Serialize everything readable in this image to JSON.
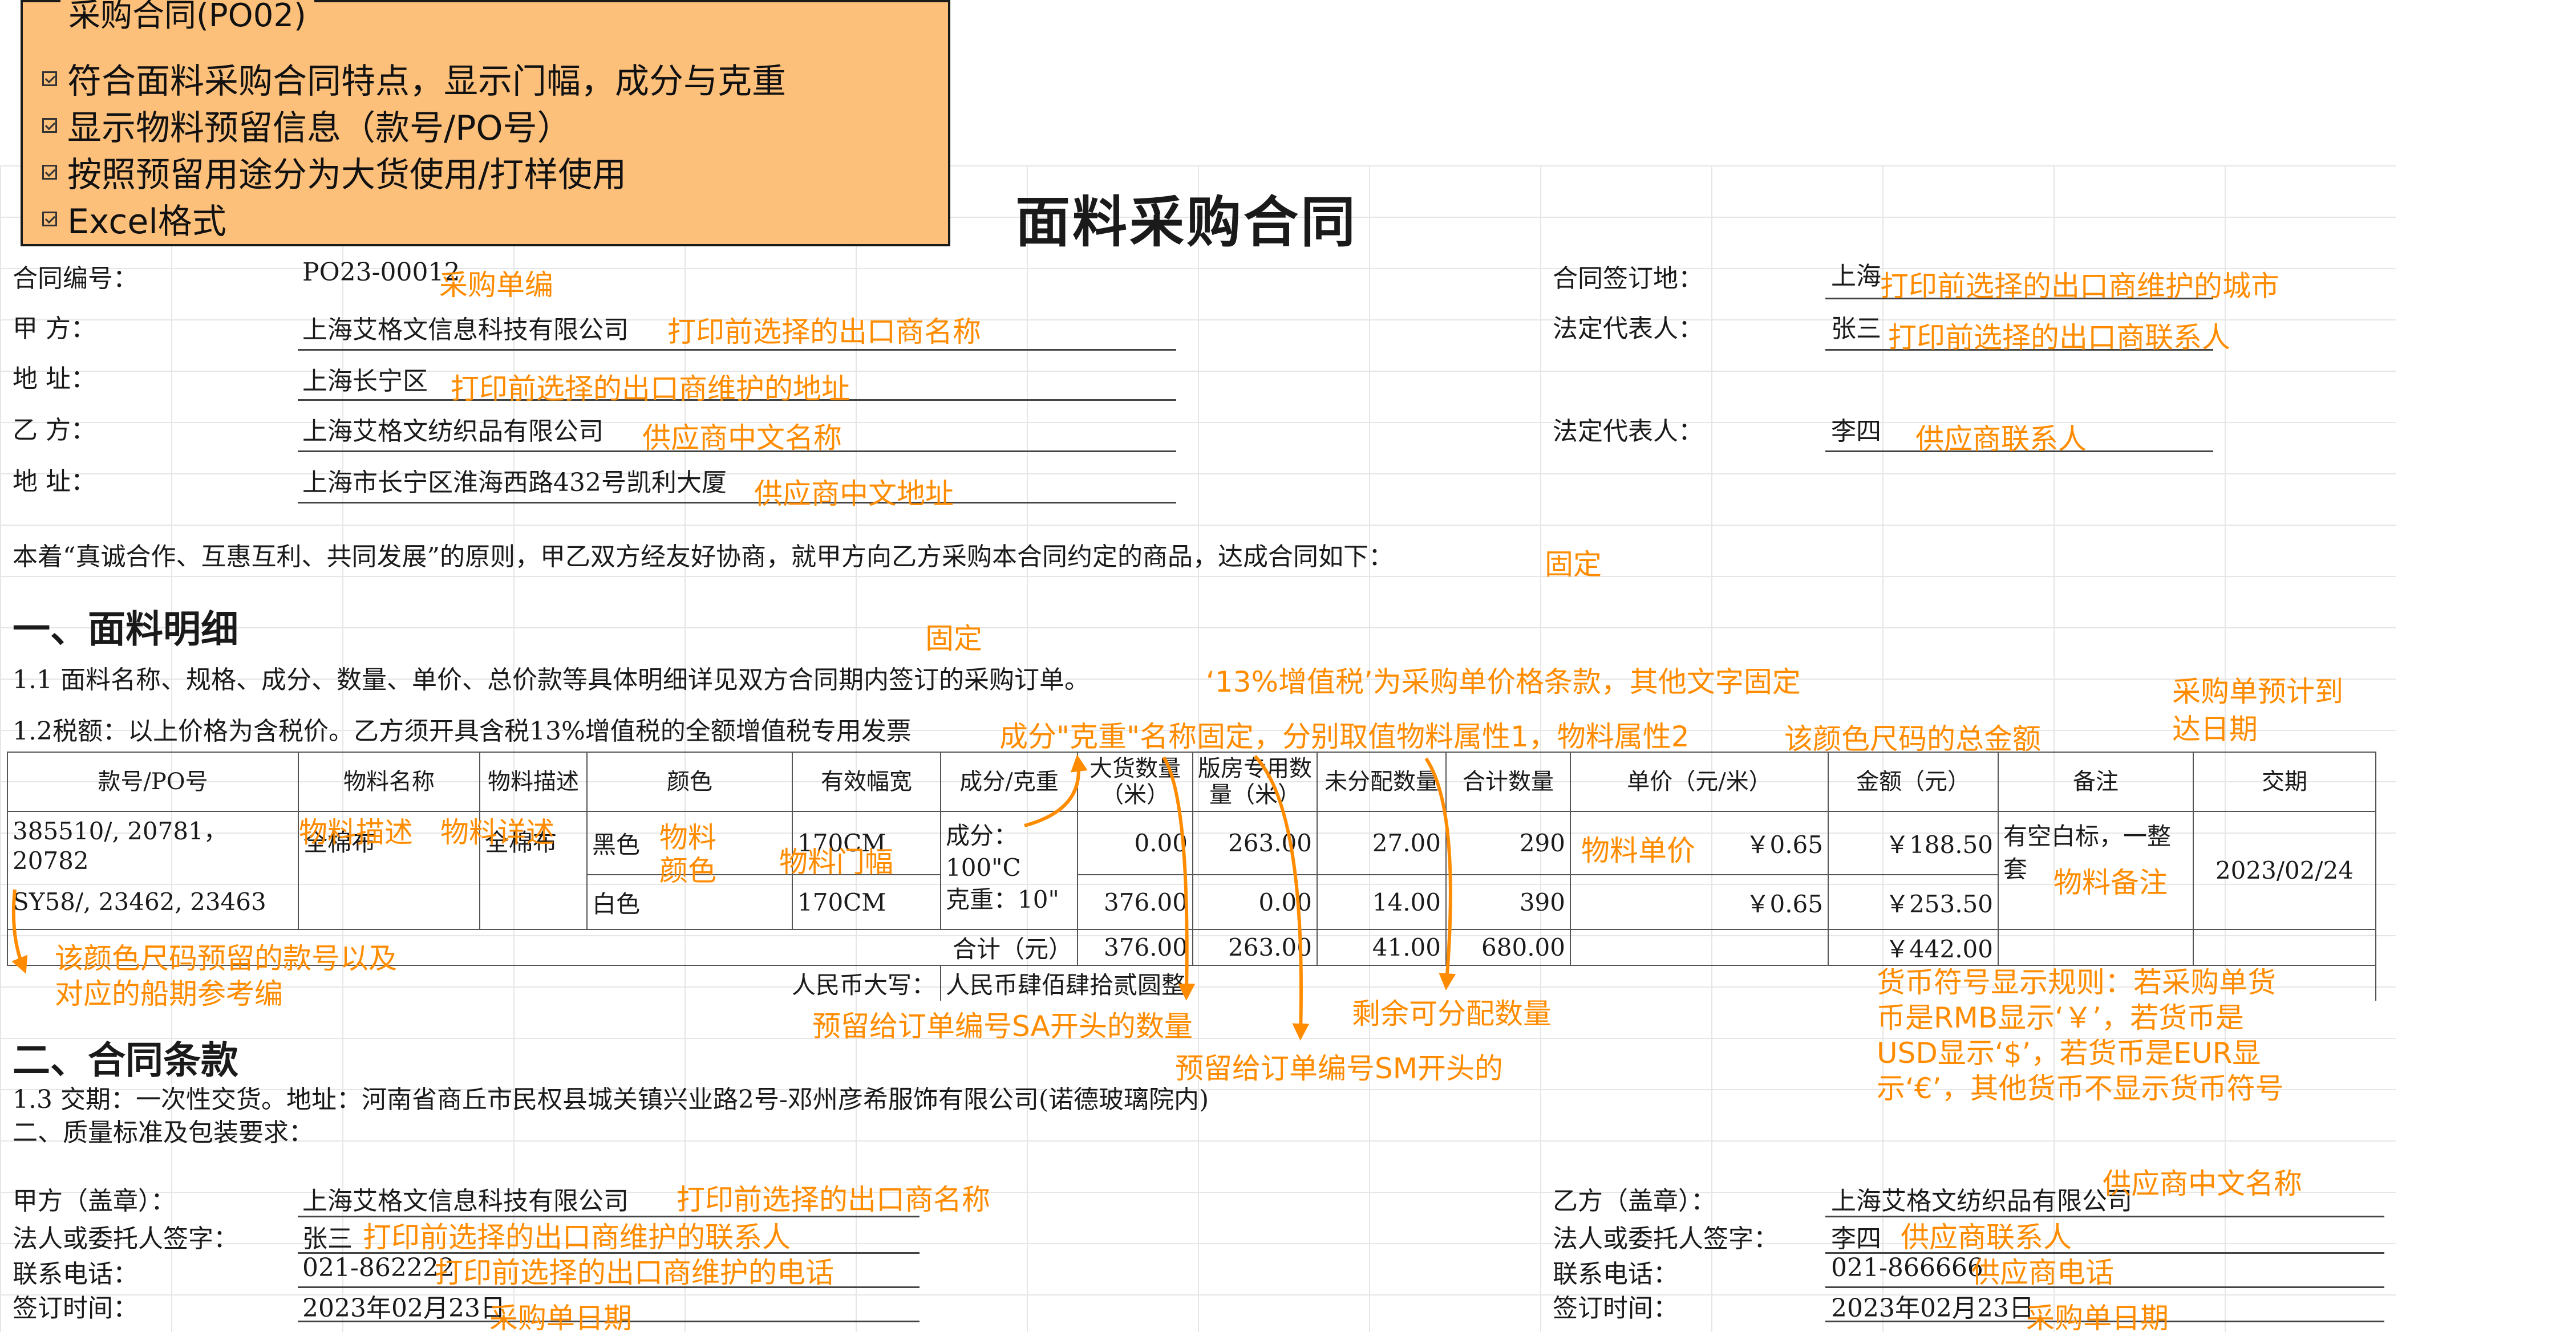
{
  "callout": {
    "title": "采购合同(PO02)",
    "items": [
      "符合面料采购合同特点，显示门幅，成分与克重",
      "显示物料预留信息（款号/PO号）",
      "按照预留用途分为大货使用/打样使用",
      "Excel格式"
    ]
  },
  "doc_title": "面料采购合同",
  "header": {
    "contract_no_label": "合同编号：",
    "contract_no": "PO23-00012",
    "party_a_label": "甲    方：",
    "party_a": "上海艾格文信息科技有限公司",
    "addr_a_label": "地    址：",
    "addr_a": "上海长宁区",
    "party_b_label": "乙    方：",
    "party_b": "上海艾格文纺织品有限公司",
    "addr_b_label": "地    址：",
    "addr_b": "上海市长宁区淮海西路432号凯利大厦",
    "sign_place_label": "合同签订地：",
    "sign_place": "上海",
    "legal_rep_a_label": "法定代表人：",
    "legal_rep_a": "张三",
    "legal_rep_b_label": "法定代表人：",
    "legal_rep_b": "李四"
  },
  "intro": "本着“真诚合作、互惠互利、共同发展”的原则，甲乙双方经友好协商，就甲方向乙方采购本合同约定的商品，达成合同如下：",
  "section1": {
    "title": "一、面料明细",
    "clause_1_1": "1.1 面料名称、规格、成分、数量、单价、总价款等具体明细详见双方合同期内签订的采购订单。",
    "clause_1_2": "1.2税额：以上价格为含税价。乙方须开具含税13%增值税的全额增值税专用发票"
  },
  "table": {
    "headers": {
      "style_po": "款号/PO号",
      "material_name": "物料名称",
      "material_desc": "物料描述",
      "color": "颜色",
      "width": "有效幅宽",
      "composition": "成分/克重",
      "bulk_qty": "大货数量（米）",
      "sample_qty": "版房专用数量（米）",
      "unallocated": "未分配数量",
      "total_qty": "合计数量",
      "unit_price": "单价（元/米）",
      "amount": "金额（元）",
      "remark": "备注",
      "delivery": "交期"
    },
    "rows": [
      {
        "style_po": "385510/, 20781， 20782",
        "color": "黑色",
        "width": "170CM",
        "bulk_qty": "0.00",
        "sample_qty": "263.00",
        "unallocated": "27.00",
        "total_qty": "290",
        "unit_price": "￥0.65",
        "amount": "￥188.50"
      },
      {
        "style_po": "SY58/, 23462, 23463",
        "color": "白色",
        "width": "170CM",
        "bulk_qty": "376.00",
        "sample_qty": "0.00",
        "unallocated": "14.00",
        "total_qty": "390",
        "unit_price": "￥0.65",
        "amount": "￥253.50"
      }
    ],
    "material_name": "全棉布",
    "material_desc": "全棉布",
    "composition_label": "成分：",
    "composition_value": "100\"C",
    "weight_label": "克重：10\"",
    "remark": "有空白标，一整套",
    "delivery": "2023/02/24",
    "total_label": "合计（元）",
    "total_bulk": "376.00",
    "total_sample": "263.00",
    "total_unallocated": "41.00",
    "total_qty": "680.00",
    "total_amount": "￥442.00",
    "capital_label": "人民币大写：",
    "capital_value": "人民币肆佰肆拾贰圆整"
  },
  "section2": {
    "title": "二、合同条款",
    "clause_1_3": "1.3 交期：一次性交货。地址：河南省商丘市民权县城关镇兴业路2号-邓州彦希服饰有限公司(诺德玻璃院内)",
    "clause_quality": "二、质量标准及包装要求："
  },
  "signature": {
    "a_seal_label": "甲方（盖章）：",
    "a_seal": "上海艾格文信息科技有限公司",
    "a_rep_label": "法人或委托人签字：",
    "a_rep": "张三",
    "a_phone_label": "联系电话：",
    "a_phone": "021-862222",
    "a_date_label": "签订时间：",
    "a_date": "2023年02月23日",
    "b_seal_label": "乙方（盖章）：",
    "b_seal": "上海艾格文纺织品有限公司",
    "b_rep_label": "法人或委托人签字：",
    "b_rep": "李四",
    "b_phone_label": "联系电话：",
    "b_phone": "021-866666",
    "b_date_label": "签订时间：",
    "b_date": "2023年02月23日"
  },
  "annotations": {
    "po_no": "采购单编",
    "exporter_name": "打印前选择的出口商名称",
    "exporter_addr": "打印前选择的出口商维护的地址",
    "supplier_name": "供应商中文名称",
    "supplier_addr": "供应商中文地址",
    "exporter_city": "打印前选择的出口商维护的城市",
    "exporter_contact": "打印前选择的出口商联系人",
    "supplier_contact": "供应商联系人",
    "fixed_intro": "固定",
    "fixed_section": "固定",
    "vat_note": "‘13%增值税’为采购单价格条款，其他文字固定",
    "composition_note": "成分\"克重\"名称固定，分别取值物料属性1，物料属性2",
    "color_size_amount": "该颜色尺码的总金额",
    "expected_arrival": "采购单预计到达日期",
    "material_desc": "物料描述",
    "material_detail": "物料详述",
    "material_color": "物料颜色",
    "material_width": "物料门幅",
    "material_price": "物料单价",
    "material_remark": "物料备注",
    "reserved_style": "该颜色尺码预留的款号以及对应的船期参考编",
    "reserved_sa": "预留给订单编号SA开头的数量",
    "reserved_sm": "预留给订单编号SM开头的",
    "remaining": "剩余可分配数量",
    "currency_rule": "货币符号显示规则：若采购单货币是RMB显示‘￥’，若货币是USD显示‘$’，若货币是EUR显示‘€’，其他货币不显示货币符号",
    "sig_exporter_name": "打印前选择的出口商名称",
    "sig_exporter_contact": "打印前选择的出口商维护的联系人",
    "sig_exporter_phone": "打印前选择的出口商维护的电话",
    "sig_po_date": "采购单日期",
    "sig_supplier_name": "供应商中文名称",
    "sig_supplier_contact": "供应商联系人",
    "sig_supplier_phone": "供应商电话",
    "sig_po_date_b": "采购单日期"
  }
}
